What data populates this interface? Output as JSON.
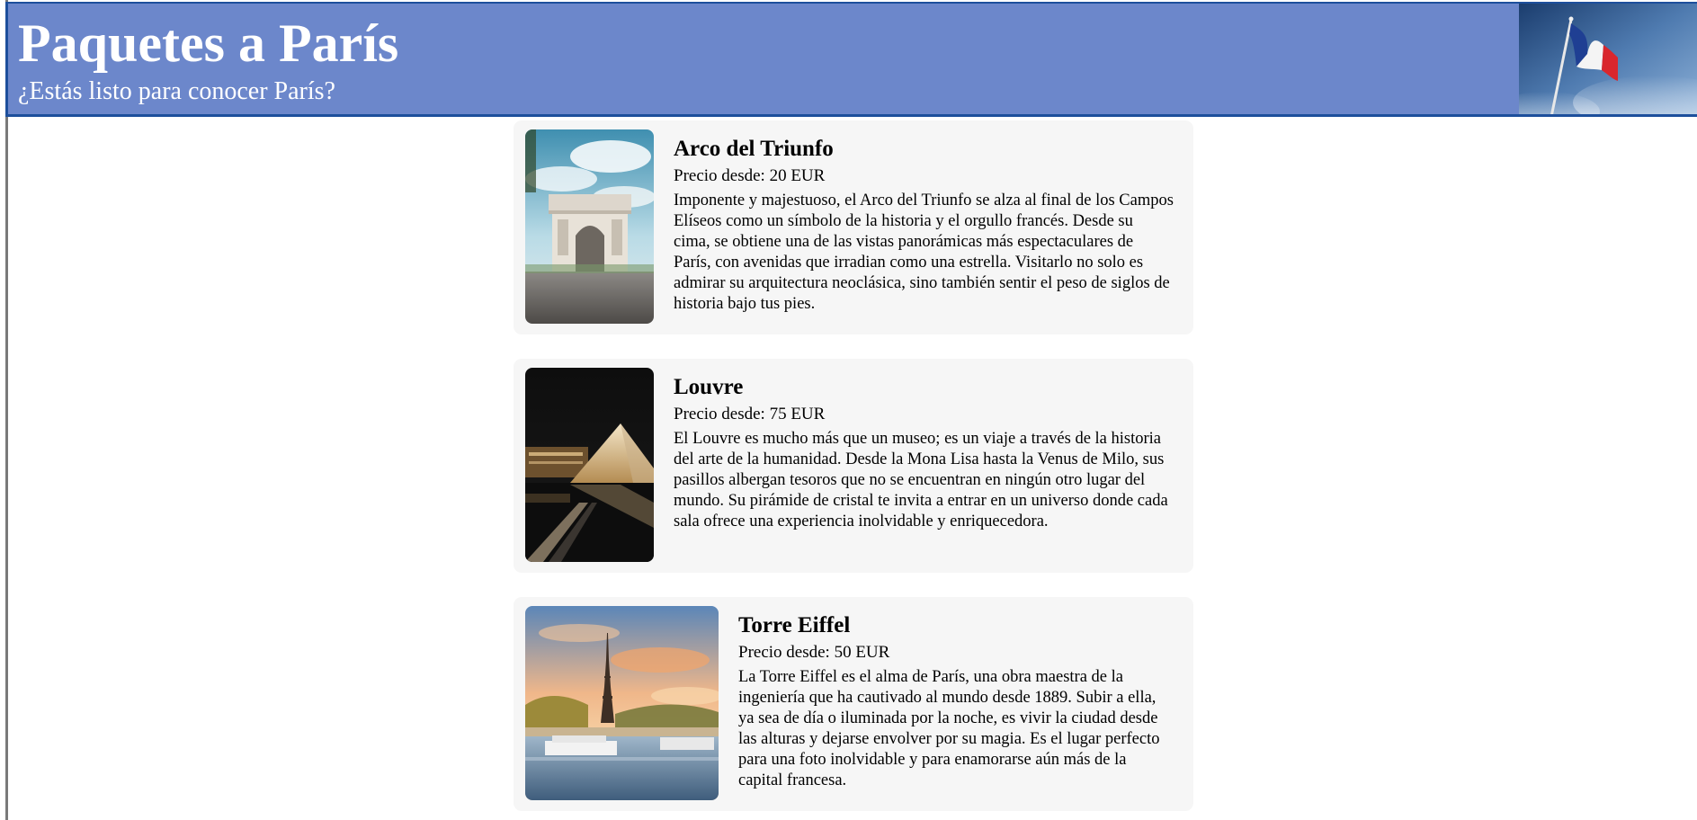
{
  "header": {
    "title": "Paquetes a París",
    "subtitle": "¿Estás listo para conocer París?",
    "banner_image": "french-flag-photo"
  },
  "colors": {
    "header_background": "#6c87cb",
    "header_border": "#1d4f9c",
    "card_background": "#f6f6f6",
    "text": "#000000"
  },
  "packages": [
    {
      "name": "Arco del Triunfo",
      "price": "Precio desde: 20 EUR",
      "description": "Imponente y majestuoso, el Arco del Triunfo se alza al final de los Campos Elíseos como un símbolo de la historia y el orgullo francés. Desde su cima, se obtiene una de las vistas panorámicas más espectaculares de París, con avenidas que irradian como una estrella. Visitarlo no solo es admirar su arquitectura neoclásica, sino también sentir el peso de siglos de historia bajo tus pies.",
      "image": "arc-de-triomphe-photo"
    },
    {
      "name": "Louvre",
      "price": "Precio desde: 75 EUR",
      "description": "El Louvre es mucho más que un museo; es un viaje a través de la historia del arte de la humanidad. Desde la Mona Lisa hasta la Venus de Milo, sus pasillos albergan tesoros que no se encuentran en ningún otro lugar del mundo. Su pirámide de cristal te invita a entrar en un universo donde cada sala ofrece una experiencia inolvidable y enriquecedora.",
      "image": "louvre-pyramid-night-photo"
    },
    {
      "name": "Torre Eiffel",
      "price": "Precio desde: 50 EUR",
      "description": "La Torre Eiffel es el alma de París, una obra maestra de la ingeniería que ha cautivado al mundo desde 1889. Subir a ella, ya sea de día o iluminada por la noche, es vivir la ciudad desde las alturas y dejarse envolver por su magia. Es el lugar perfecto para una foto inolvidable y para enamorarse aún más de la capital francesa.",
      "image": "eiffel-tower-sunset-photo"
    }
  ]
}
